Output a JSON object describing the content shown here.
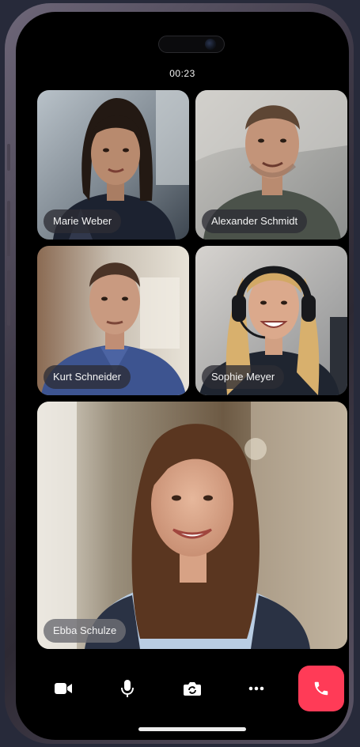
{
  "call": {
    "timer": "00:23"
  },
  "participants": [
    {
      "name": "Marie Weber"
    },
    {
      "name": "Alexander Schmidt"
    },
    {
      "name": "Kurt Schneider"
    },
    {
      "name": "Sophie Meyer"
    },
    {
      "name": "Ebba Schulze"
    }
  ],
  "controls": {
    "icons": [
      "video-camera-icon",
      "microphone-icon",
      "switch-camera-icon",
      "more-icon",
      "phone-hangup-icon"
    ],
    "end_call_color": "#ff3b57"
  }
}
